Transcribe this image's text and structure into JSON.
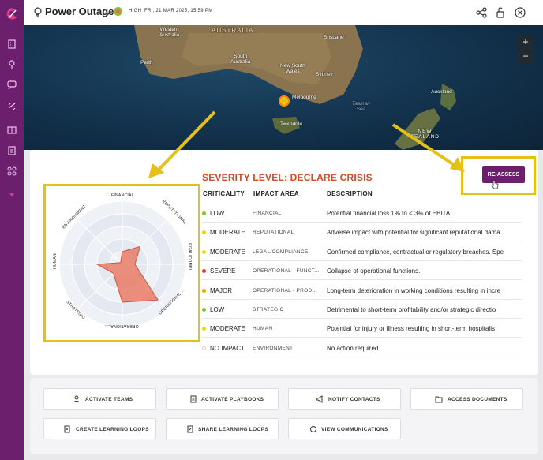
{
  "header": {
    "title": "Power Outage",
    "severity_label": "HIGH",
    "timestamp": "FRI, 21 MAR 2025, 15:59 PM"
  },
  "map": {
    "labels": {
      "australia": "AUSTRALIA",
      "western_australia": "Western\nAustralia",
      "south_australia": "South\nAustralia",
      "perth": "Perth",
      "brisbane": "Brisbane",
      "nsw": "New South\nWales",
      "sydney": "Sydney",
      "melbourne": "Melbourne",
      "tasmania": "Tasmania",
      "tasman_sea": "Tasman\nSea",
      "auckland": "Auckland",
      "new_zealand": "NEW\nZEALAND"
    },
    "zoom_in": "+",
    "zoom_out": "−"
  },
  "severity": {
    "title": "SEVERITY LEVEL: DECLARE CRISIS",
    "reassess_label": "RE-ASSESS",
    "columns": [
      "CRITICALITY",
      "IMPACT AREA",
      "DESCRIPTION"
    ],
    "rows": [
      {
        "criticality": "LOW",
        "area": "FINANCIAL",
        "description": "Potential financial loss 1% to < 3% of EBITA.",
        "color": "#7cc242"
      },
      {
        "criticality": "MODERATE",
        "area": "REPUTATIONAL",
        "description": "Adverse impact with potential for significant reputational dama",
        "color": "#f2d026"
      },
      {
        "criticality": "MODERATE",
        "area": "LEGAL/COMPLIANCE",
        "description": "Confirmed compliance, contractual or regulatory breaches. Spe",
        "color": "#f2d026"
      },
      {
        "criticality": "SEVERE",
        "area": "OPERATIONAL - FUNCT...",
        "description": "Collapse of operational functions.",
        "color": "#e0382c"
      },
      {
        "criticality": "MAJOR",
        "area": "OPERATIONAL - PROD...",
        "description": "Long-term deterioration in working conditions resulting in incre",
        "color": "#f29a1f"
      },
      {
        "criticality": "LOW",
        "area": "STRATEGIC",
        "description": "Detrimental to short-term profitability and/or strategic directio",
        "color": "#7cc242"
      },
      {
        "criticality": "MODERATE",
        "area": "HUMAN",
        "description": "Potential for injury or illness resulting in short-term hospitalis",
        "color": "#f2d026"
      },
      {
        "criticality": "NO IMPACT",
        "area": "ENVIRONMENT",
        "description": "No action required",
        "color": "#ffffff"
      }
    ]
  },
  "radar": {
    "axes": [
      "FINANCIAL",
      "REPUTATIONAL",
      "LEGAL/COMPL...",
      "OPERATIONAL...",
      "OPERATIONAL...",
      "STRATEGIC",
      "HUMAN",
      "ENVIRONMENT"
    ],
    "levels": [
      1,
      2,
      1,
      4,
      3,
      1,
      2,
      0
    ],
    "max": 5,
    "fill_color": "#e8735e"
  },
  "actions": {
    "activate_teams": "ACTIVATE TEAMS",
    "activate_playbooks": "ACTIVATE PLAYBOOKS",
    "notify_contacts": "NOTIFY CONTACTS",
    "access_documents": "ACCESS DOCUMENTS",
    "create_learning_loops": "CREATE LEARNING LOOPS",
    "share_learning_loops": "SHARE LEARNING LOOPS",
    "view_communications": "VIEW COMMUNICATIONS"
  },
  "colors": {
    "brand": "#6b1f6c",
    "highlight": "#e6c01a",
    "severity_title": "#d64a23"
  }
}
